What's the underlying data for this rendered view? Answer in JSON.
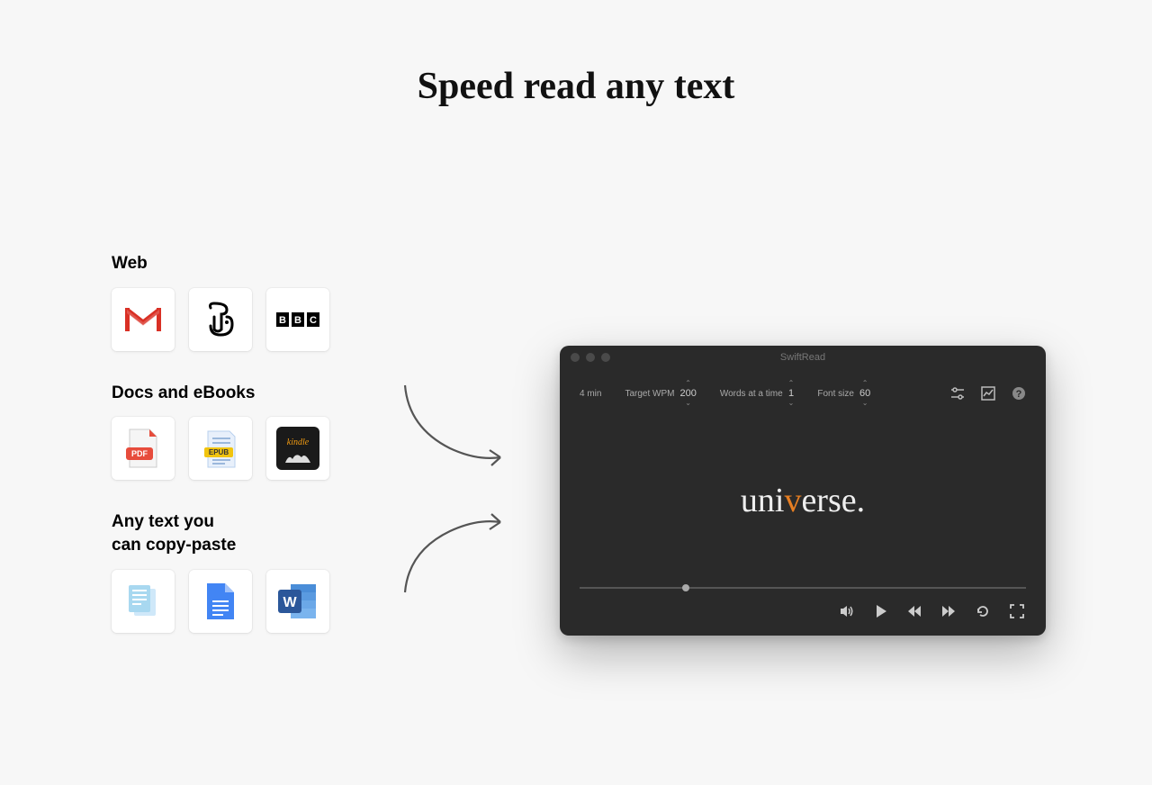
{
  "title": "Speed read any text",
  "sections": {
    "web": {
      "label": "Web"
    },
    "docs": {
      "label": "Docs and eBooks"
    },
    "anytext": {
      "label": "Any text you\ncan copy-paste"
    }
  },
  "icons": {
    "gmail": "Gmail",
    "nyt": "NYT",
    "bbc": "BBC",
    "pdf": "PDF",
    "epub": "EPUB",
    "kindle": "kindle",
    "text": "Text",
    "gdocs": "Google Docs",
    "word": "Word"
  },
  "app": {
    "window_title": "SwiftRead",
    "time_remaining": "4 min",
    "wpm_label": "Target WPM",
    "wpm_value": "200",
    "words_label": "Words at a time",
    "words_value": "1",
    "fontsize_label": "Font size",
    "fontsize_value": "60",
    "reader_pre": "uni",
    "reader_accent": "v",
    "reader_post": "erse."
  }
}
